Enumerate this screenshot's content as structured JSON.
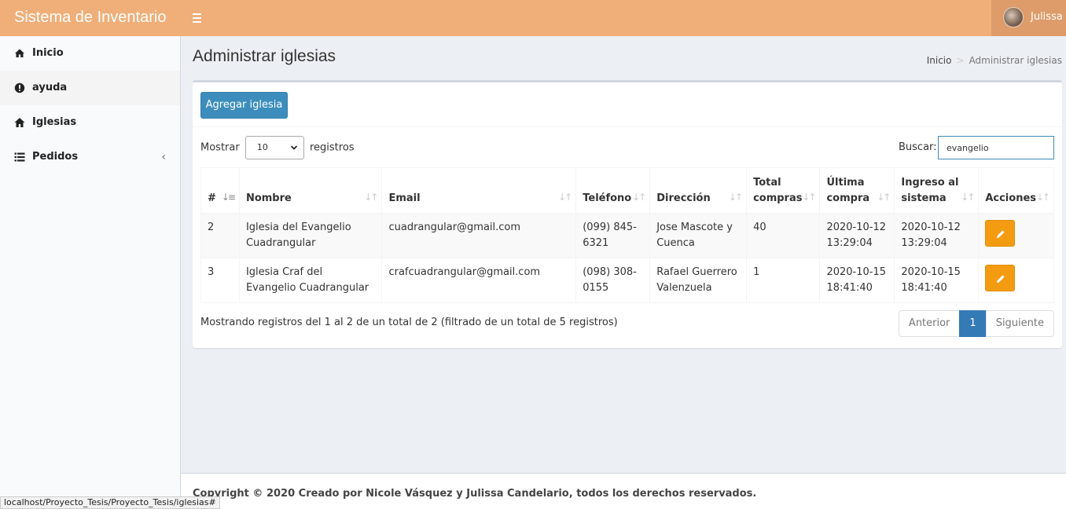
{
  "app": {
    "title": "Sistema de Inventario"
  },
  "header": {
    "user_name": "Julissa"
  },
  "sidebar": {
    "items": [
      {
        "label": "Inicio",
        "icon": "dashboard-icon"
      },
      {
        "label": "ayuda",
        "icon": "exclamation-circle-icon"
      },
      {
        "label": "Iglesias",
        "icon": "home-icon"
      },
      {
        "label": "Pedidos",
        "icon": "list-icon",
        "arrow": "‹"
      }
    ]
  },
  "page": {
    "title": "Administrar iglesias",
    "breadcrumb": {
      "home": "Inicio",
      "sep": ">",
      "current": "Administrar iglesias"
    }
  },
  "toolbar": {
    "add_label": "Agregar iglesia"
  },
  "table_controls": {
    "show_label": "Mostrar",
    "page_size": "10",
    "records_label": "registros",
    "search_label": "Buscar:",
    "search_value": "evangelio"
  },
  "table": {
    "headers": [
      "#",
      "Nombre",
      "Email",
      "Teléfono",
      "Dirección",
      "Total compras",
      "Última compra",
      "Ingreso al sistema",
      "Acciones"
    ],
    "rows": [
      {
        "num": "2",
        "nombre": "Iglesia del Evangelio Cuadrangular",
        "email": "cuadrangular@gmail.com",
        "telefono": "(099) 845-6321",
        "direccion": "Jose Mascote y Cuenca",
        "total": "40",
        "ultima": "2020-10-12 13:29:04",
        "ingreso": "2020-10-12 13:29:04"
      },
      {
        "num": "3",
        "nombre": "Iglesia Craf del Evangelio Cuadrangular",
        "email": "crafcuadrangular@gmail.com",
        "telefono": "(098) 308-0155",
        "direccion": "Rafael Guerrero Valenzuela",
        "total": "1",
        "ultima": "2020-10-15 18:41:40",
        "ingreso": "2020-10-15 18:41:40"
      }
    ]
  },
  "info": "Mostrando registros del 1 al 2 de un total de 2 (filtrado de un total de 5 registros)",
  "pagination": {
    "prev": "Anterior",
    "current": "1",
    "next": "Siguiente"
  },
  "footer": {
    "text": "Copyright © 2020 Creado por Nicole Vásquez y Julissa Candelario, todos los derechos reservados."
  },
  "statusbar": {
    "url": "localhost/Proyecto_Tesis/Proyecto_Tesis/iglesias#"
  },
  "colors": {
    "header": "#f0ae78",
    "primary": "#3c8dbc",
    "warning": "#f39c12"
  }
}
